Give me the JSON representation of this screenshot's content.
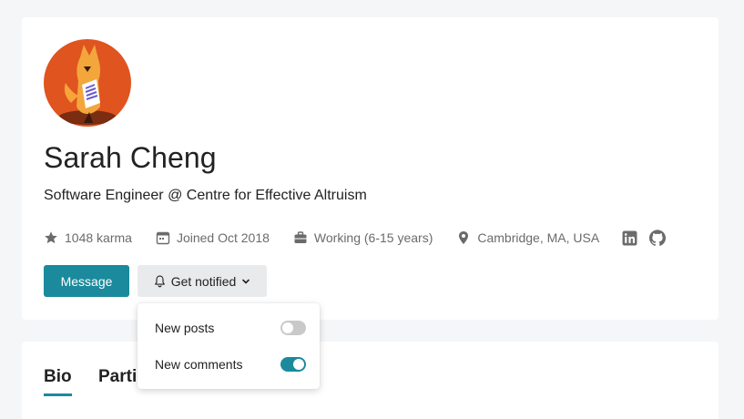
{
  "profile": {
    "name": "Sarah Cheng",
    "bio": "Software Engineer @ Centre for Effective Altruism",
    "avatar_icon": "fox-illustration-avatar",
    "meta": {
      "karma": "1048 karma",
      "joined": "Joined Oct 2018",
      "experience": "Working (6-15 years)",
      "location": "Cambridge, MA, USA"
    },
    "social_icons": [
      "linkedin-icon",
      "github-icon"
    ]
  },
  "actions": {
    "message_label": "Message",
    "notify_label": "Get notified"
  },
  "notify_menu": {
    "items": [
      {
        "label": "New posts",
        "enabled": false
      },
      {
        "label": "New comments",
        "enabled": true
      }
    ]
  },
  "tabs": [
    {
      "label": "Bio",
      "active": true
    },
    {
      "label": "Parti"
    }
  ],
  "colors": {
    "accent": "#1b8a9c",
    "background": "#f5f6f8",
    "muted_text": "#6b6b6b",
    "avatar_bg": "#e0541f"
  }
}
